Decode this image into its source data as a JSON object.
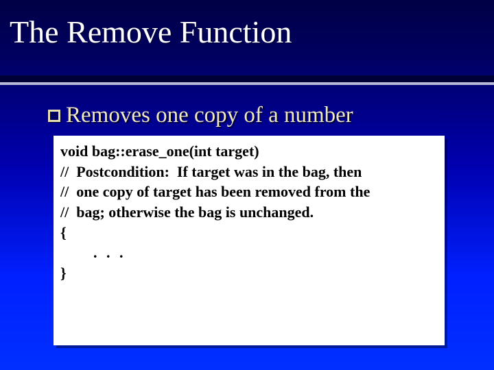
{
  "title": "The Remove Function",
  "bullet": "Removes one copy of a number",
  "code": {
    "l1": "void bag::erase_one(int target)",
    "l2": "//  Postcondition:  If target was in the bag, then",
    "l3": "//  one copy of target has been removed from the",
    "l4": "//  bag; otherwise the bag is unchanged.",
    "l5": "{",
    "ellipsis": ". . .",
    "l6": "}"
  }
}
